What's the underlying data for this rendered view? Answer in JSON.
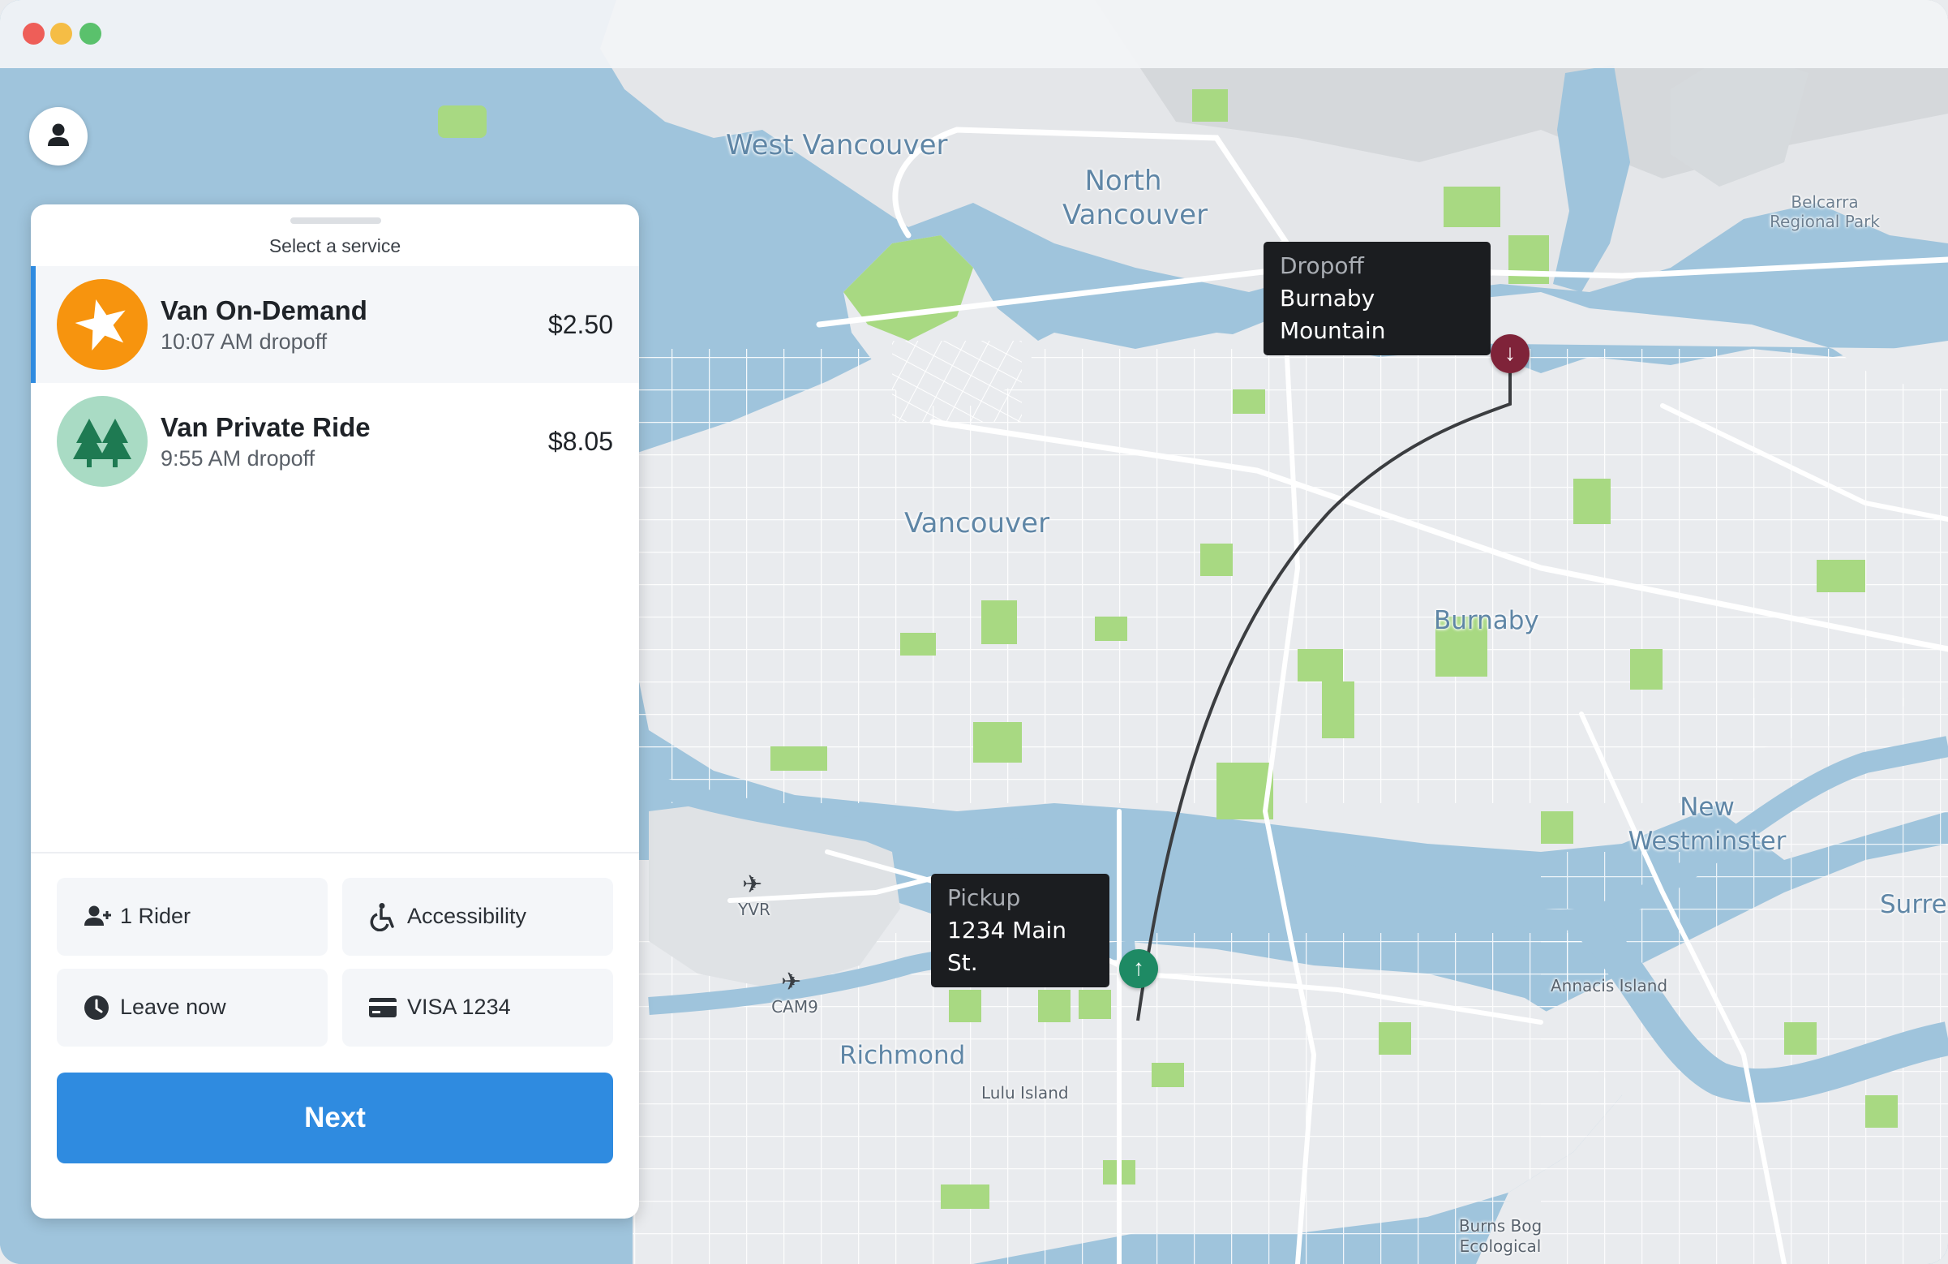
{
  "window": {
    "controls": [
      "close",
      "minimize",
      "zoom"
    ]
  },
  "profile": {
    "icon": "person-icon"
  },
  "panel": {
    "title": "Select a service",
    "services": [
      {
        "name": "Van On-Demand",
        "eta": "10:07 AM dropoff",
        "price": "$2.50",
        "icon": "star-icon",
        "selected": true,
        "color": "#f7940e"
      },
      {
        "name": "Van Private Ride",
        "eta": "9:55 AM dropoff",
        "price": "$8.05",
        "icon": "trees-icon",
        "selected": false,
        "color": "#a9dbc4"
      }
    ],
    "options": {
      "riders": "1 Rider",
      "accessibility": "Accessibility",
      "time": "Leave now",
      "payment": "VISA 1234"
    },
    "next_label": "Next"
  },
  "map": {
    "labels": {
      "west_vancouver": "West Vancouver",
      "north_vancouver_1": "North",
      "north_vancouver_2": "Vancouver",
      "belcarra_1": "Belcarra",
      "belcarra_2": "Regional Park",
      "vancouver": "Vancouver",
      "burnaby": "Burnaby",
      "new_westminster_1": "New",
      "new_westminster_2": "Westminster",
      "surrey": "Surre",
      "richmond": "Richmond",
      "lulu_island": "Lulu Island",
      "annacis_island": "Annacis Island",
      "burns_bog_1": "Burns Bog",
      "burns_bog_2": "Ecological",
      "yvr": "YVR",
      "cam9": "CAM9"
    },
    "dropoff": {
      "label": "Dropoff",
      "value": "Burnaby Mountain",
      "color": "#7f2339"
    },
    "pickup": {
      "label": "Pickup",
      "value": "1234 Main St.",
      "color": "#1e8a64"
    }
  },
  "colors": {
    "accent": "#2f8be0",
    "water": "#9fc4dc",
    "land": "#e9ebee",
    "park": "#a8d982"
  }
}
